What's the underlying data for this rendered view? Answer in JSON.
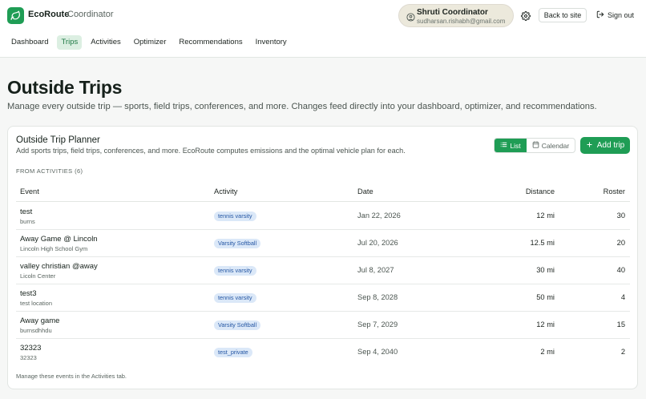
{
  "app": {
    "brand": "EcoRoute",
    "role": "Coordinator"
  },
  "user": {
    "name": "Shruti Coordinator",
    "email": "sudharsan.rishabh@gmail.com"
  },
  "header": {
    "back_label": "Back to site",
    "signout_label": "Sign out"
  },
  "nav": {
    "items": [
      {
        "label": "Dashboard",
        "active": false
      },
      {
        "label": "Trips",
        "active": true
      },
      {
        "label": "Activities",
        "active": false
      },
      {
        "label": "Optimizer",
        "active": false
      },
      {
        "label": "Recommendations",
        "active": false
      },
      {
        "label": "Inventory",
        "active": false
      }
    ]
  },
  "page": {
    "title": "Outside Trips",
    "subtitle": "Manage every outside trip — sports, field trips, conferences, and more. Changes feed directly into your dashboard, optimizer, and recommendations."
  },
  "planner": {
    "title": "Outside Trip Planner",
    "subtitle": "Add sports trips, field trips, conferences, and more. EcoRoute computes emissions and the optimal vehicle plan for each.",
    "view_list": "List",
    "view_calendar": "Calendar",
    "active_view": "List",
    "add_label": "Add trip",
    "section_label": "FROM ACTIVITIES (6)",
    "columns": [
      "Event",
      "Activity",
      "Date",
      "Distance",
      "Roster"
    ],
    "rows": [
      {
        "event": "test",
        "location": "burns",
        "activity": "tennis varsity",
        "date": "Jan 22, 2026",
        "distance": "12 mi",
        "roster": "30"
      },
      {
        "event": "Away Game @ Lincoln",
        "location": "Lincoln High School Gym",
        "activity": "Varsity Softball",
        "date": "Jul 20, 2026",
        "distance": "12.5 mi",
        "roster": "20"
      },
      {
        "event": "valley christian @away",
        "location": "Licoln Center",
        "activity": "tennis varsity",
        "date": "Jul 8, 2027",
        "distance": "30 mi",
        "roster": "40"
      },
      {
        "event": "test3",
        "location": "test location",
        "activity": "tennis varsity",
        "date": "Sep 8, 2028",
        "distance": "50 mi",
        "roster": "4"
      },
      {
        "event": "Away game",
        "location": "burnsdhhdu",
        "activity": "Varsity Softball",
        "date": "Sep 7, 2029",
        "distance": "12 mi",
        "roster": "15"
      },
      {
        "event": "32323",
        "location": "32323",
        "activity": "test_private",
        "date": "Sep 4, 2040",
        "distance": "2 mi",
        "roster": "2"
      }
    ],
    "footer_note": "Manage these events in the Activities tab."
  },
  "colors": {
    "accent": "#1f9d55",
    "tag_bg": "#dbe8f8",
    "tag_text": "#2456a3",
    "user_pill": "#ece9dc"
  },
  "icons": {
    "logo": "leaf-icon",
    "user": "user-icon",
    "settings": "gear-icon",
    "signout": "sign-out-icon",
    "list": "list-icon",
    "calendar": "calendar-icon",
    "add": "plus-icon"
  }
}
